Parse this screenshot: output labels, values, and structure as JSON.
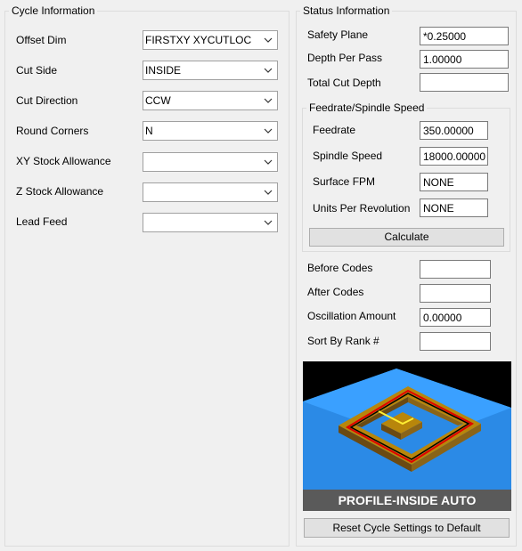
{
  "cycle": {
    "title": "Cycle Information",
    "fields": [
      {
        "label": "Offset Dim",
        "value": "FIRSTXY XYCUTLOC"
      },
      {
        "label": "Cut Side",
        "value": "INSIDE"
      },
      {
        "label": "Cut Direction",
        "value": "CCW"
      },
      {
        "label": "Round Corners",
        "value": "N"
      },
      {
        "label": "XY Stock Allowance",
        "value": ""
      },
      {
        "label": "Z Stock Allowance",
        "value": ""
      },
      {
        "label": "Lead Feed",
        "value": ""
      }
    ]
  },
  "status": {
    "title": "Status Information",
    "fields": [
      {
        "label": "Safety Plane",
        "value": "*0.25000"
      },
      {
        "label": "Depth Per Pass",
        "value": "1.00000"
      },
      {
        "label": "Total Cut Depth",
        "value": ""
      }
    ],
    "feed": {
      "title": "Feedrate/Spindle Speed",
      "fields": [
        {
          "label": "Feedrate",
          "value": "350.00000"
        },
        {
          "label": "Spindle Speed",
          "value": "18000.00000"
        },
        {
          "label": "Surface FPM",
          "value": "NONE"
        },
        {
          "label": "Units Per Revolution",
          "value": "NONE"
        }
      ],
      "calculate_label": "Calculate"
    },
    "extra": [
      {
        "label": "Before Codes",
        "value": ""
      },
      {
        "label": "After Codes",
        "value": ""
      },
      {
        "label": "Oscillation Amount",
        "value": "0.00000"
      },
      {
        "label": "Sort By Rank #",
        "value": ""
      }
    ],
    "preview_caption": "PROFILE-INSIDE AUTO",
    "reset_label": "Reset Cycle Settings to Default"
  }
}
